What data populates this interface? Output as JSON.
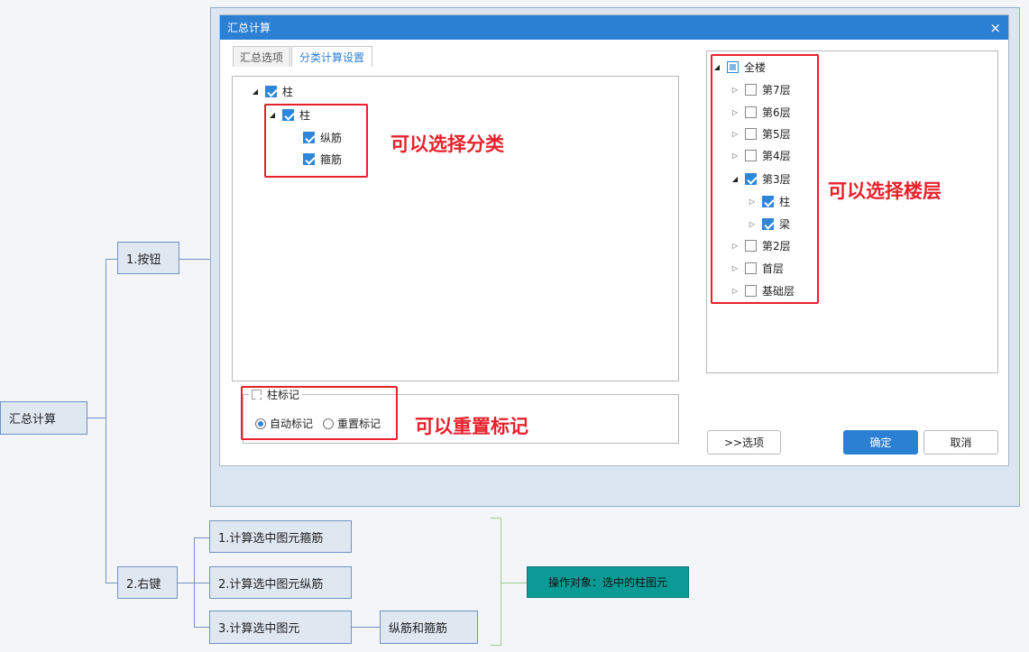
{
  "mindmap": {
    "root": "汇总计算",
    "branch1": "1.按钮",
    "branch2": "2.右键",
    "sub1": "1.计算选中图元箍筋",
    "sub2": "2.计算选中图元纵筋",
    "sub3": "3.计算选中图元",
    "sub3_child": "纵筋和箍筋",
    "note": "操作对象：选中的柱图元"
  },
  "dialog": {
    "title": "汇总计算",
    "close": "×",
    "tabs": [
      "汇总选项",
      "分类计算设置"
    ],
    "left_tree": [
      "柱",
      "柱",
      "纵筋",
      "箍筋"
    ],
    "mark_group_label": "柱标记",
    "radio_auto": "自动标记",
    "radio_reset": "重置标记",
    "floor_tree": {
      "all": "全楼",
      "floors": [
        "第7层",
        "第6层",
        "第5层",
        "第4层",
        "第3层"
      ],
      "floor3_children": [
        "柱",
        "梁"
      ],
      "floors_after": [
        "第2层",
        "首层",
        "基础层"
      ]
    },
    "buttons": {
      "options": ">>选项",
      "ok": "确定",
      "cancel": "取消"
    }
  },
  "annotations": {
    "category": "可以选择分类",
    "floor": "可以选择楼层",
    "reset": "可以重置标记"
  },
  "colors": {
    "accent": "#2c80d4",
    "annotation": "#e8212b",
    "note_bg": "#0b9a96"
  }
}
